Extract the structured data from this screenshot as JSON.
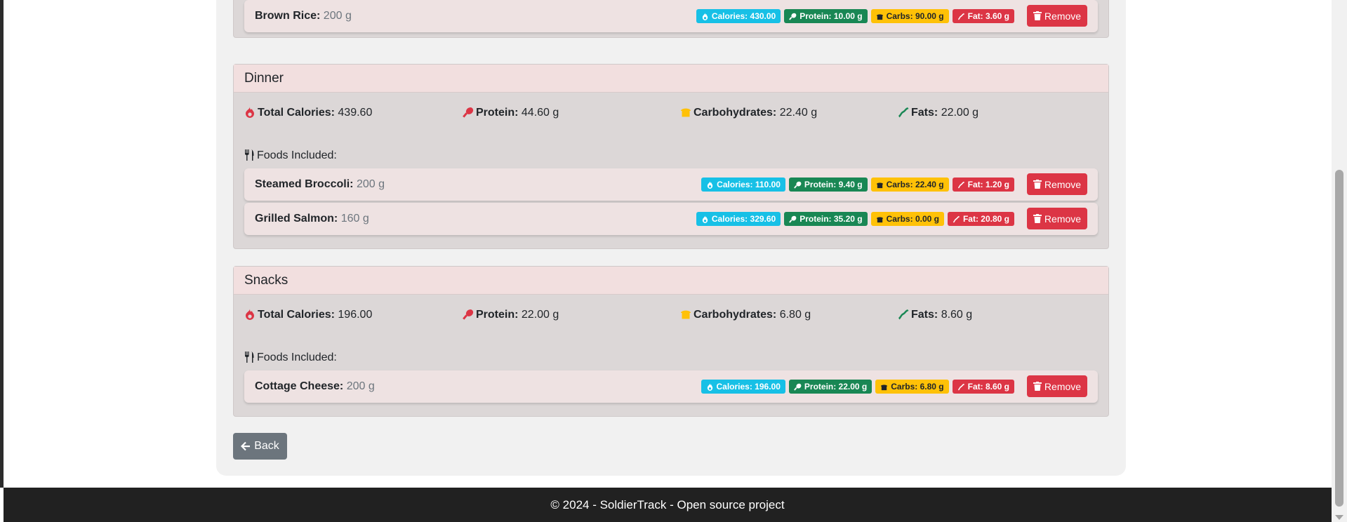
{
  "meals": [
    {
      "id": "lunch",
      "foods": [
        {
          "name": "Brown Rice:",
          "qty": "200 g",
          "calories": "Calories: 430.00",
          "protein": "Protein: 10.00 g",
          "carbs": "Carbs: 90.00 g",
          "fat": "Fat: 3.60 g"
        }
      ]
    },
    {
      "id": "dinner",
      "title": "Dinner",
      "totals": {
        "calories_label": "Total Calories:",
        "calories_value": "439.60",
        "protein_label": "Protein:",
        "protein_value": "44.60 g",
        "carbs_label": "Carbohydrates:",
        "carbs_value": "22.40 g",
        "fats_label": "Fats:",
        "fats_value": "22.00 g"
      },
      "foods_label": "Foods Included:",
      "foods": [
        {
          "name": "Steamed Broccoli:",
          "qty": "200 g",
          "calories": "Calories: 110.00",
          "protein": "Protein: 9.40 g",
          "carbs": "Carbs: 22.40 g",
          "fat": "Fat: 1.20 g"
        },
        {
          "name": "Grilled Salmon:",
          "qty": "160 g",
          "calories": "Calories: 329.60",
          "protein": "Protein: 35.20 g",
          "carbs": "Carbs: 0.00 g",
          "fat": "Fat: 20.80 g"
        }
      ]
    },
    {
      "id": "snacks",
      "title": "Snacks",
      "totals": {
        "calories_label": "Total Calories:",
        "calories_value": "196.00",
        "protein_label": "Protein:",
        "protein_value": "22.00 g",
        "carbs_label": "Carbohydrates:",
        "carbs_value": "6.80 g",
        "fats_label": "Fats:",
        "fats_value": "8.60 g"
      },
      "foods_label": "Foods Included:",
      "foods": [
        {
          "name": "Cottage Cheese:",
          "qty": "200 g",
          "calories": "Calories: 196.00",
          "protein": "Protein: 22.00 g",
          "carbs": "Carbs: 6.80 g",
          "fat": "Fat: 8.60 g"
        }
      ]
    }
  ],
  "remove_label": "Remove",
  "back_label": "Back",
  "footer_text": "© 2024 - SoldierTrack - Open source project",
  "icons": {
    "calories": "fire-icon",
    "protein": "drumstick-icon",
    "carbs": "bread-icon",
    "fat": "bacon-icon",
    "foods": "utensils-icon",
    "remove": "trash-icon",
    "back": "arrow-left-icon"
  },
  "colors": {
    "calories_badge": "#17c0e6",
    "protein_badge": "#198754",
    "carbs_badge": "#ffc107",
    "fat_badge": "#dc3545",
    "remove_button": "#dc3545",
    "back_button": "#6c757d",
    "meal_header": "#f2dfdf",
    "footer": "#212121"
  }
}
